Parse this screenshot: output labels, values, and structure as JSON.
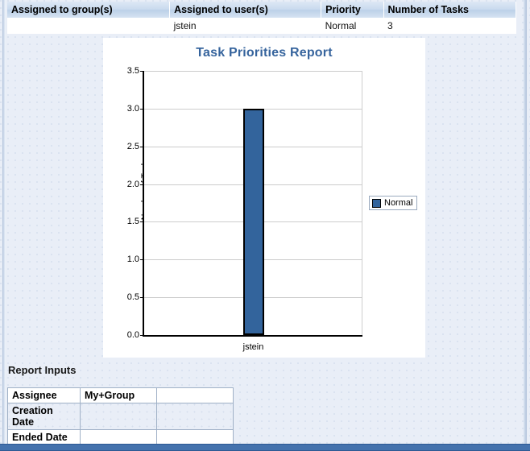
{
  "results_table": {
    "headers": [
      "Assigned to group(s)",
      "Assigned to user(s)",
      "Priority",
      "Number of Tasks"
    ],
    "rows": [
      {
        "group": "",
        "user": "jstein",
        "priority": "Normal",
        "count": "3"
      }
    ]
  },
  "chart_data": {
    "type": "bar",
    "title": "Task Priorities Report",
    "xlabel": "",
    "ylabel": "Number of Tasks",
    "categories": [
      "jstein"
    ],
    "series": [
      {
        "name": "Normal",
        "values": [
          3
        ],
        "color": "#33649c"
      }
    ],
    "ylim": [
      0.0,
      3.5
    ],
    "yticks": [
      "0.0",
      "0.5",
      "1.0",
      "1.5",
      "2.0",
      "2.5",
      "3.0",
      "3.5"
    ],
    "ytick_values": [
      0.0,
      0.5,
      1.0,
      1.5,
      2.0,
      2.5,
      3.0,
      3.5
    ],
    "grid": true,
    "legend_position": "right",
    "title_color": "#36649d"
  },
  "report_inputs": {
    "heading": "Report Inputs",
    "rows": [
      {
        "label": "Assignee",
        "value": "My+Group",
        "value2": ""
      },
      {
        "label": "Creation Date",
        "value": "",
        "value2": ""
      },
      {
        "label": "Ended Date",
        "value": "",
        "value2": ""
      }
    ]
  }
}
